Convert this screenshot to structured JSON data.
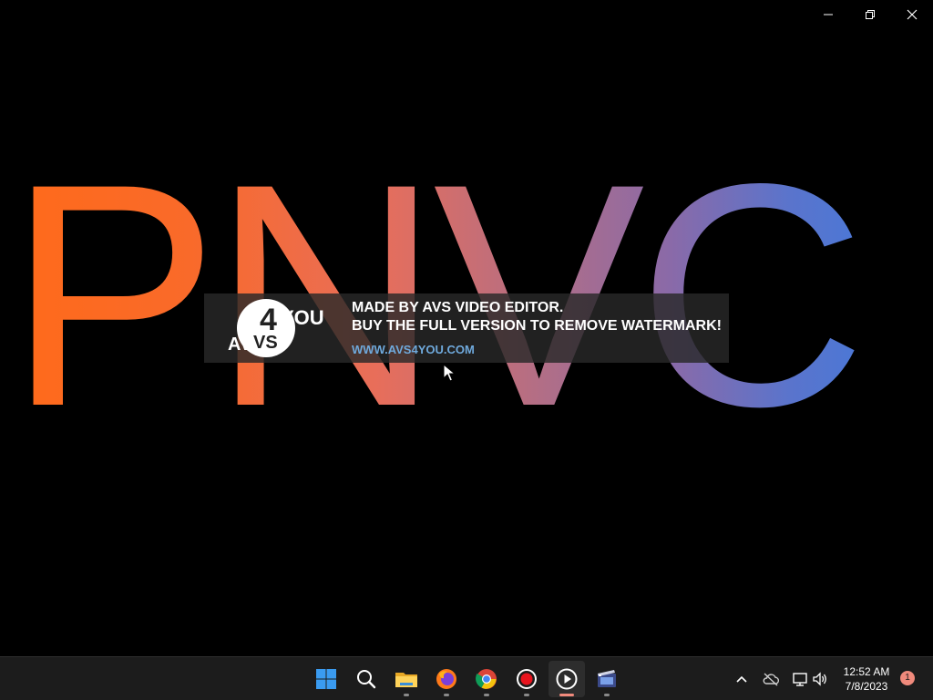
{
  "window": {
    "controls": [
      "minimize",
      "restore",
      "close"
    ]
  },
  "video": {
    "big_text": "PNVC",
    "gradient": [
      "#ff6a1a",
      "#e86e5a",
      "#8a6aa8",
      "#3e7bdf"
    ]
  },
  "watermark": {
    "logo_text_main": "AVS",
    "logo_text_num": "4",
    "logo_text_you": "YOU",
    "line1": "MADE BY AVS VIDEO EDITOR.",
    "line2": "BUY THE FULL VERSION TO REMOVE WATERMARK!",
    "link": "WWW.AVS4YOU.COM",
    "link_color": "#6fa9dc"
  },
  "taskbar": {
    "apps": [
      {
        "name": "start-icon"
      },
      {
        "name": "search-icon"
      },
      {
        "name": "file-explorer-icon"
      },
      {
        "name": "firefox-icon"
      },
      {
        "name": "chrome-icon"
      },
      {
        "name": "record-icon"
      },
      {
        "name": "media-player-icon",
        "active": true
      },
      {
        "name": "video-editor-icon"
      }
    ],
    "clock": {
      "time": "12:52 AM",
      "date": "7/8/2023"
    },
    "notification_count": "1",
    "accent": "#f08a7c"
  }
}
